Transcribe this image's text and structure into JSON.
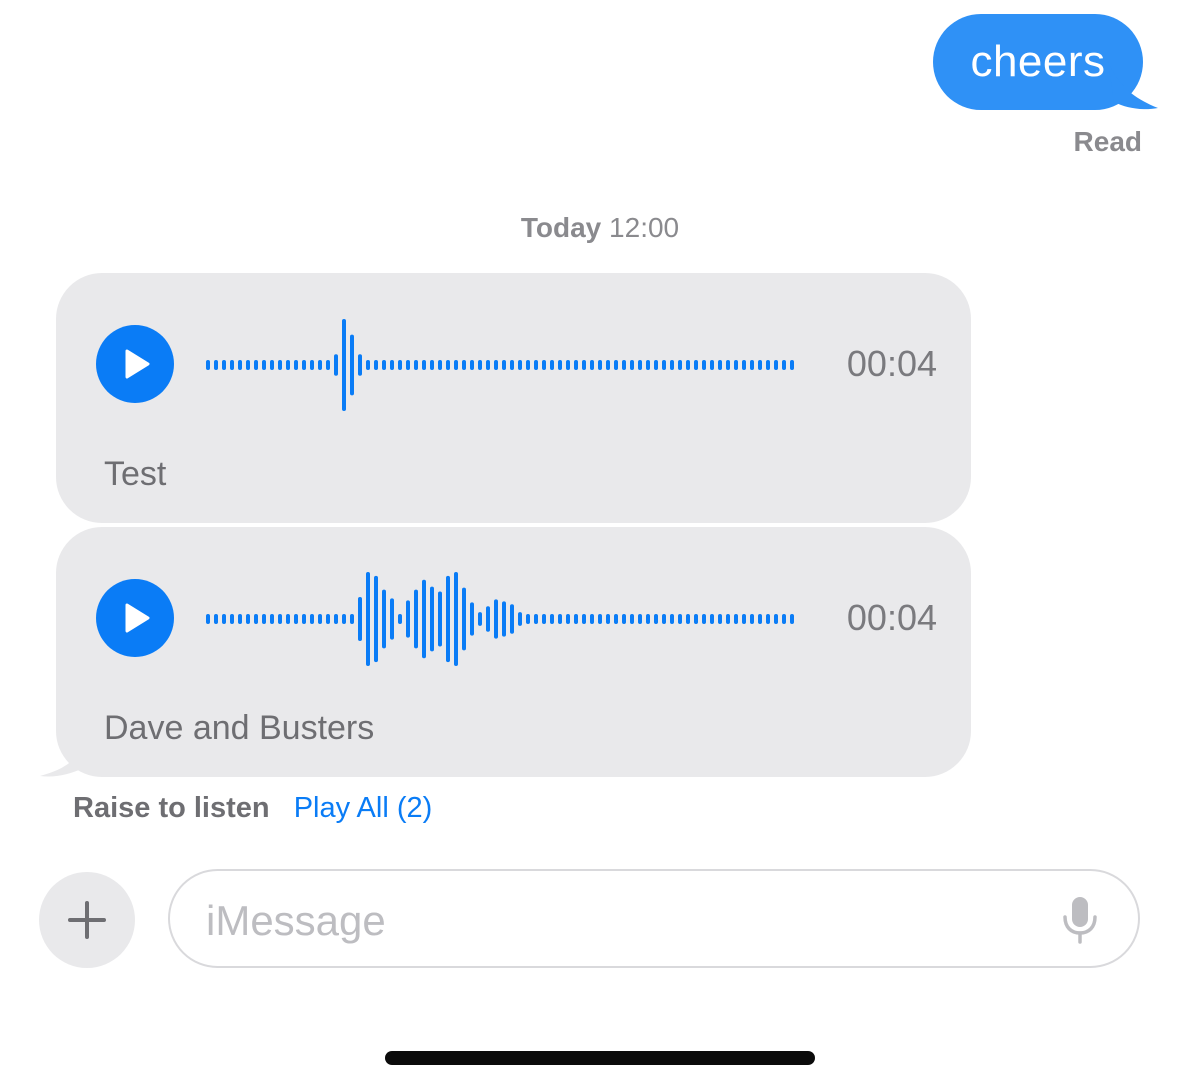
{
  "outgoing": {
    "text": "cheers",
    "status": "Read"
  },
  "timestamp": {
    "day": "Today",
    "time": "12:00"
  },
  "audio_messages": [
    {
      "duration": "00:04",
      "caption": "Test",
      "waveform": [
        5,
        5,
        5,
        5,
        5,
        5,
        5,
        5,
        5,
        5,
        5,
        5,
        5,
        5,
        5,
        5,
        22,
        94,
        62,
        22,
        5,
        5,
        5,
        5,
        5,
        5,
        5,
        5,
        5,
        5,
        5,
        5,
        5,
        5,
        5,
        5,
        5,
        5,
        5,
        5,
        5,
        5,
        5,
        5,
        5,
        5,
        5,
        5,
        5,
        5,
        5,
        5,
        5,
        5,
        5,
        5,
        5,
        5,
        5,
        5,
        5,
        5,
        5,
        5,
        5,
        5,
        5,
        5,
        5,
        5,
        5,
        5,
        5,
        5
      ]
    },
    {
      "duration": "00:04",
      "caption": "Dave and Busters",
      "waveform": [
        5,
        5,
        5,
        5,
        5,
        5,
        5,
        5,
        5,
        5,
        5,
        5,
        5,
        5,
        5,
        5,
        5,
        5,
        5,
        45,
        96,
        88,
        60,
        42,
        10,
        38,
        60,
        80,
        66,
        56,
        88,
        96,
        64,
        34,
        14,
        26,
        40,
        36,
        30,
        14,
        5,
        5,
        5,
        5,
        5,
        5,
        5,
        5,
        5,
        5,
        5,
        5,
        5,
        5,
        5,
        5,
        5,
        5,
        5,
        5,
        5,
        5,
        5,
        5,
        5,
        5,
        5,
        5,
        5,
        5,
        5,
        5,
        5,
        5
      ]
    }
  ],
  "footer": {
    "raise_to_listen": "Raise to listen",
    "play_all": "Play All (2)"
  },
  "composer": {
    "placeholder": "iMessage"
  },
  "colors": {
    "accent": "#0a7cf6",
    "bubble_out": "#2f91f6",
    "bubble_in": "#e9e9eb"
  }
}
